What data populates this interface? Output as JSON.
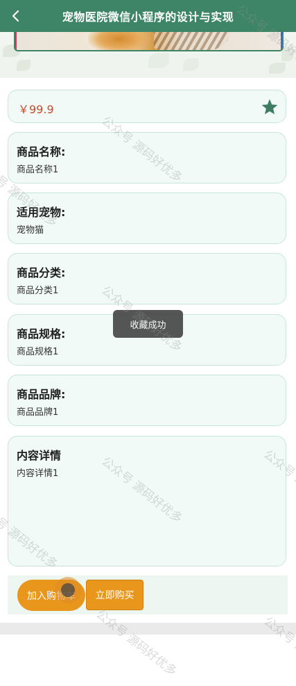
{
  "header": {
    "title": "宠物医院微信小程序的设计与实现"
  },
  "product": {
    "price": "￥99.9"
  },
  "fields": [
    {
      "title": "商品名称:",
      "value": "商品名称1"
    },
    {
      "title": "适用宠物:",
      "value": "宠物猫"
    },
    {
      "title": "商品分类:",
      "value": "商品分类1"
    },
    {
      "title": "商品规格:",
      "value": "商品规格1"
    },
    {
      "title": "商品品牌:",
      "value": "商品品牌1"
    }
  ],
  "detail": {
    "title": "内容详情",
    "value": "内容详情1"
  },
  "toast": {
    "message": "收藏成功"
  },
  "actions": {
    "add_to_cart": "加入购物车",
    "buy_now": "立即购买"
  },
  "watermark": {
    "text": "公众号 源码好优多"
  },
  "colors": {
    "header": "#3d8566",
    "price": "#c84a2a",
    "star": "#3d7d63",
    "button": "#e8961c",
    "card_bg": "#f1faf6",
    "card_border": "#c7e6da"
  },
  "icons": {
    "back": "chevron-left-icon",
    "favorite": "star-icon"
  }
}
